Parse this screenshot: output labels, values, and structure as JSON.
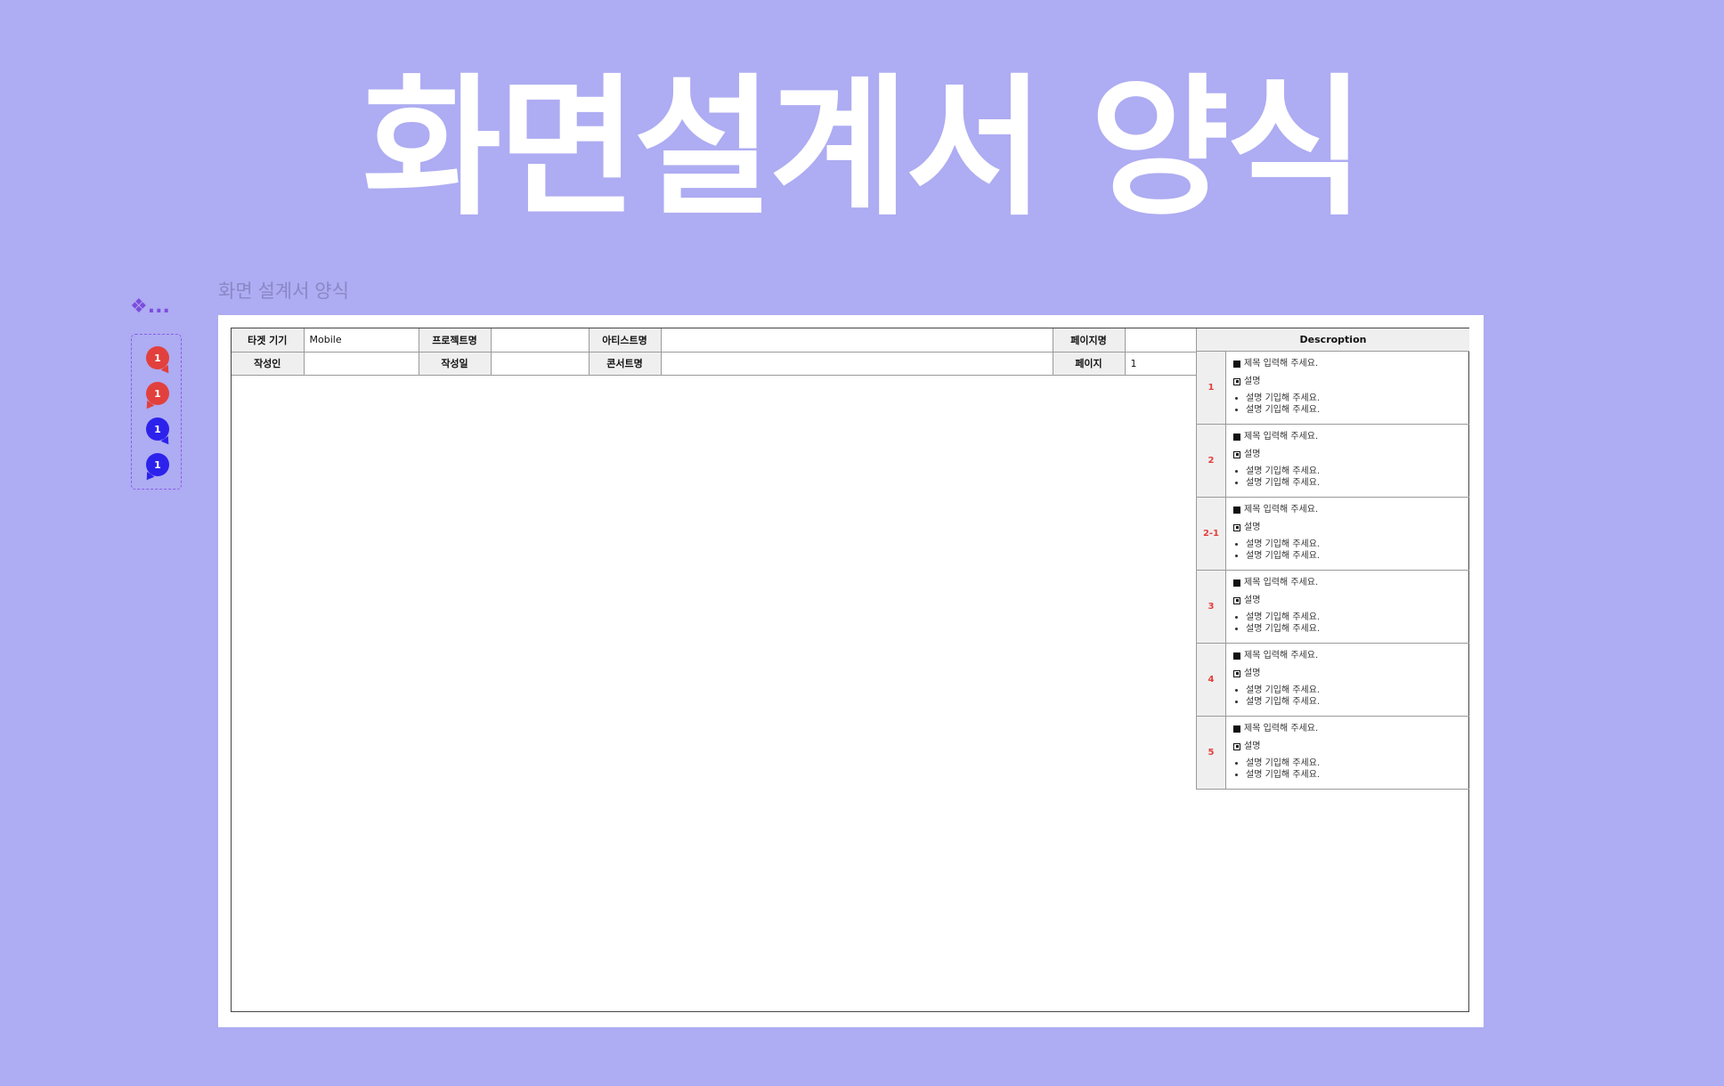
{
  "hero": {
    "title": "화면설계서 양식"
  },
  "frame": {
    "label": "화면 설계서 양식"
  },
  "component_icon": {
    "glyph": "❖..."
  },
  "markers": [
    {
      "number": "1",
      "color": "#e2403d",
      "icon": "speech-bubble-red-right-icon"
    },
    {
      "number": "1",
      "color": "#e2403d",
      "icon": "speech-bubble-red-left-icon"
    },
    {
      "number": "1",
      "color": "#2c22ec",
      "icon": "speech-bubble-blue-right-icon"
    },
    {
      "number": "1",
      "color": "#2c22ec",
      "icon": "speech-bubble-blue-left-icon"
    }
  ],
  "header": {
    "target_device_label": "타겟 기기",
    "target_device_value": "Mobile",
    "project_label": "프로젝트명",
    "project_value": "",
    "artist_label": "아티스트명",
    "artist_value": "",
    "page_name_label": "페이지명",
    "page_name_value": "",
    "author_label": "작성인",
    "author_value": "",
    "date_label": "작성일",
    "date_value": "",
    "concert_label": "콘서트명",
    "concert_value": "",
    "page_label": "페이지",
    "page_value": "1"
  },
  "description": {
    "header": "Descroption",
    "rows": [
      {
        "num": "1",
        "title": "제목 입력해 주세요.",
        "sub": "설명",
        "bullets": [
          "설명 기입해 주세요.",
          "설명 기입해 주세요."
        ]
      },
      {
        "num": "2",
        "title": "제목 입력해 주세요.",
        "sub": "설명",
        "bullets": [
          "설명 기입해 주세요.",
          "설명 기입해 주세요."
        ]
      },
      {
        "num": "2-1",
        "title": "제목 입력해 주세요.",
        "sub": "설명",
        "bullets": [
          "설명 기입해 주세요.",
          "설명 기입해 주세요."
        ]
      },
      {
        "num": "3",
        "title": "제목 입력해 주세요.",
        "sub": "설명",
        "bullets": [
          "설명 기입해 주세요.",
          "설명 기입해 주세요."
        ]
      },
      {
        "num": "4",
        "title": "제목 입력해 주세요.",
        "sub": "설명",
        "bullets": [
          "설명 기입해 주세요.",
          "설명 기입해 주세요."
        ]
      },
      {
        "num": "5",
        "title": "제목 입력해 주세요.",
        "sub": "설명",
        "bullets": [
          "설명 기입해 주세요.",
          "설명 기입해 주세요."
        ]
      }
    ]
  },
  "colors": {
    "background": "#aeacf2",
    "accent_red": "#e2403d",
    "accent_blue": "#2c22ec",
    "header_gray": "#efefef"
  }
}
